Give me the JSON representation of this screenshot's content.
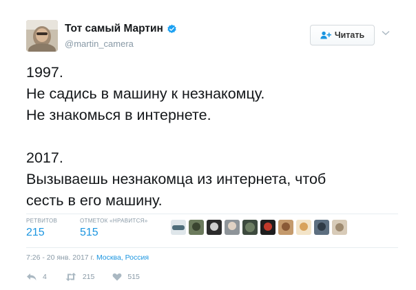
{
  "header": {
    "display_name": "Тот самый Мартин",
    "handle": "@martin_camera",
    "follow_label": "Читать"
  },
  "tweet": {
    "lines_1": [
      "1997.",
      "Не садись в машину к незнакомцу.",
      "Не знакомься в интернете."
    ],
    "lines_2": [
      "2017.",
      "Вызываешь незнакомца из интернета, чтоб",
      "сесть в его машину."
    ]
  },
  "stats": {
    "retweets_label": "РЕТВИТОВ",
    "retweets_count": "215",
    "likes_label": "ОТМЕТОК «НРАВИТСЯ»",
    "likes_count": "515"
  },
  "timestamp": {
    "time": "7:26 - 20 янв. 2017 г.",
    "location": "Москва, Россия"
  },
  "actions": {
    "reply_count": "4",
    "retweet_count": "215",
    "like_count": "515"
  },
  "colors": {
    "link_blue": "#1b95e0",
    "muted_gray": "#8899a6",
    "text": "#14171a"
  }
}
